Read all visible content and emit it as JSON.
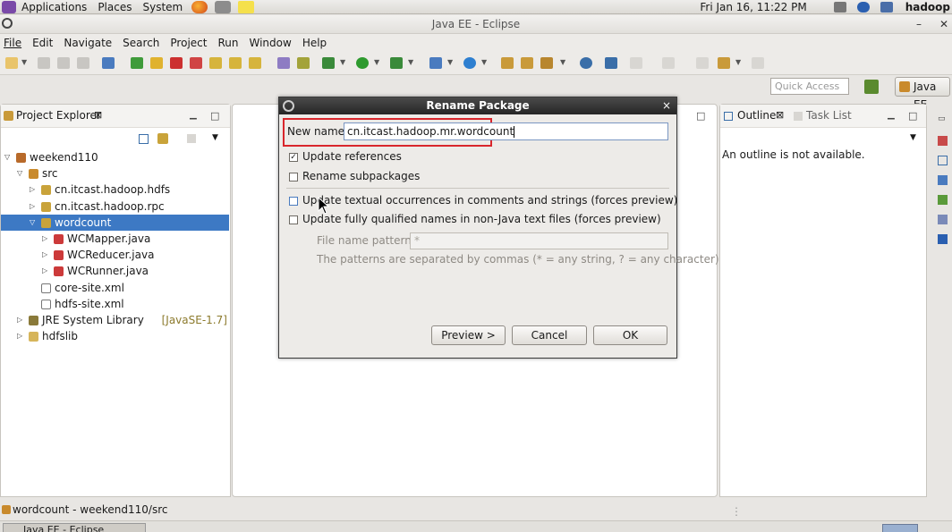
{
  "panel": {
    "menus": [
      "Applications",
      "Places",
      "System"
    ],
    "clock": "Fri Jan 16, 11:22 PM",
    "user": "hadoop"
  },
  "window": {
    "title": "Java EE - Eclipse",
    "min_symbol": "–",
    "close_symbol": "✕"
  },
  "menubar": {
    "items": [
      "File",
      "Edit",
      "Navigate",
      "Search",
      "Project",
      "Run",
      "Window",
      "Help"
    ]
  },
  "toolbar": {
    "quick_access_placeholder": "Quick Access",
    "perspective_label": "Java EE"
  },
  "project_explorer": {
    "tab_label": "Project Explorer",
    "tree": [
      {
        "label": "weekend110",
        "twisty": "▽",
        "icon": "project-icon",
        "level": 0
      },
      {
        "label": "src",
        "twisty": "▽",
        "icon": "source-folder-icon",
        "level": 1
      },
      {
        "label": "cn.itcast.hadoop.hdfs",
        "twisty": "▷",
        "icon": "package-icon",
        "level": 2
      },
      {
        "label": "cn.itcast.hadoop.rpc",
        "twisty": "▷",
        "icon": "package-icon",
        "level": 2
      },
      {
        "label": "wordcount",
        "twisty": "▽",
        "icon": "package-icon",
        "level": 2,
        "selected": true
      },
      {
        "label": "WCMapper.java",
        "twisty": "▷",
        "icon": "java-file-icon",
        "level": 3
      },
      {
        "label": "WCReducer.java",
        "twisty": "▷",
        "icon": "java-file-icon",
        "level": 3
      },
      {
        "label": "WCRunner.java",
        "twisty": "▷",
        "icon": "java-file-icon",
        "level": 3
      },
      {
        "label": "core-site.xml",
        "twisty": "",
        "icon": "xml-file-icon",
        "level": 2
      },
      {
        "label": "hdfs-site.xml",
        "twisty": "",
        "icon": "xml-file-icon",
        "level": 2
      },
      {
        "label": "JRE System Library",
        "decor": "[JavaSE-1.7]",
        "twisty": "▷",
        "icon": "library-icon",
        "level": 1
      },
      {
        "label": "hdfslib",
        "twisty": "▷",
        "icon": "folder-icon",
        "level": 1
      }
    ]
  },
  "outline": {
    "tab_outline": "Outline",
    "tab_tasks": "Task List",
    "message": "An outline is not available."
  },
  "status": {
    "text": "wordcount - weekend110/src",
    "taskbar_item": "Java EE - Eclipse"
  },
  "dialog": {
    "title": "Rename Package",
    "close": "×",
    "new_name_label": "New name:",
    "new_name_value": "cn.itcast.hadoop.mr.wordcount",
    "update_references": "Update references",
    "rename_subpackages": "Rename subpackages",
    "update_textual": "Update textual occurrences in comments and strings (forces preview)",
    "update_qualified": "Update fully qualified names in non-Java text files (forces preview)",
    "file_patterns_label": "File name patterns:",
    "file_patterns_value": "*",
    "patterns_hint": "The patterns are separated by commas (* = any string, ? = any character)",
    "preview_button": "Preview >",
    "cancel_button": "Cancel",
    "ok_button": "OK",
    "checks": {
      "update_references": true,
      "rename_subpackages": false,
      "update_textual": false,
      "update_qualified": false
    }
  },
  "colors": {
    "selection": "#3d79c4",
    "highlight_box": "#d9262c"
  }
}
